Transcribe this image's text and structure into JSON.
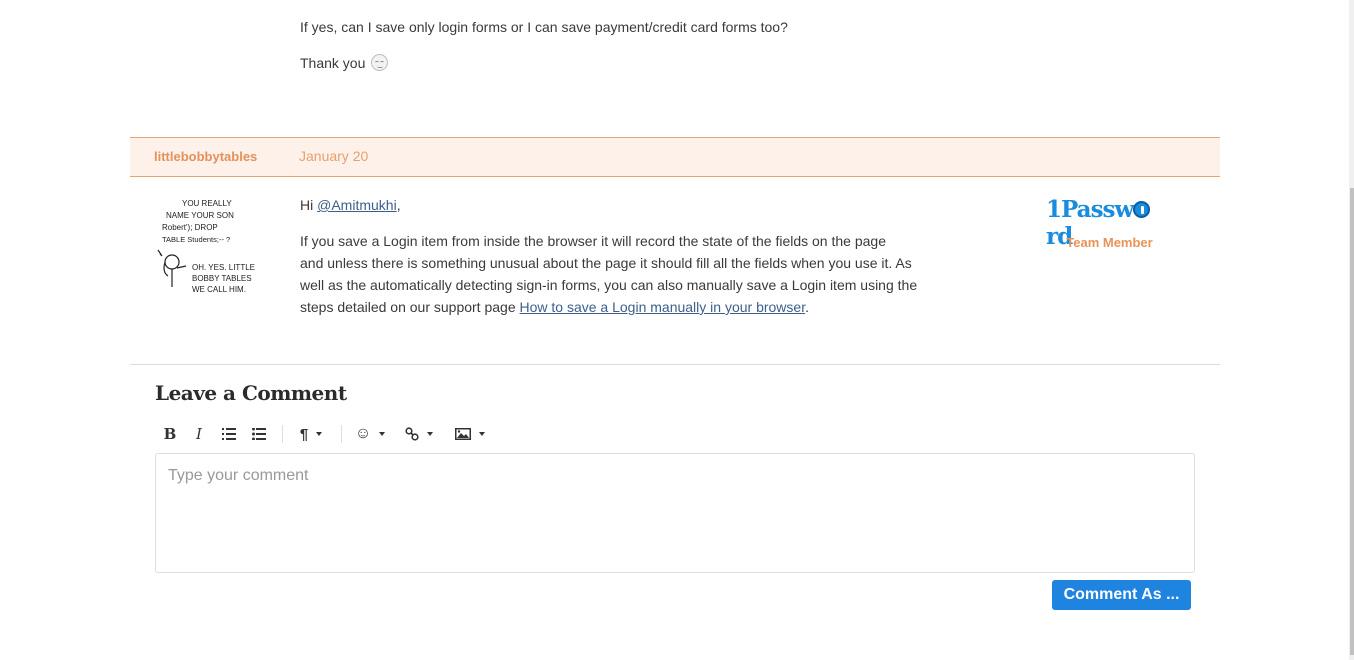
{
  "previous_post": {
    "question": "If yes, can I save only login forms or I can save payment/credit card forms too?",
    "thanks": "Thank you",
    "emoji": "smile-emoji"
  },
  "reply": {
    "author": "littlebobbytables",
    "date": "January 20",
    "avatar_icon": "xkcd-bobby-tables-avatar",
    "avatar_text": [
      "YOU REALLY",
      "NAME YOUR SON",
      "Robert'); DROP",
      "TABLE Students;-- ?",
      "OH. YES. LITTLE",
      "BOBBY TABLES",
      "WE CALL HIM."
    ],
    "greeting_prefix": "Hi ",
    "mention": "@Amitmukhi",
    "greeting_suffix": ",",
    "body_lines": [
      "If you save a Login item from inside the browser it will record the state of the fields on the page",
      "and unless there is something unusual about the page it should fill all the fields when you use it. As",
      "well as the automatically detecting sign-in forms, you can also manually save a Login item using the"
    ],
    "last_line_prefix": "steps detailed on our support page ",
    "support_link": "How to save a Login manually in your browser",
    "last_line_suffix": ".",
    "badge": {
      "logo_part1": "1Passw",
      "logo_part2": "rd",
      "role": "Team Member"
    }
  },
  "comment_form": {
    "title": "Leave a Comment",
    "toolbar": {
      "bold": "B",
      "italic": "I",
      "ordered_list": "ordered-list-icon",
      "unordered_list": "unordered-list-icon",
      "paragraph": "¶",
      "emoji": "☺",
      "link": "link-icon",
      "image": "image-icon"
    },
    "placeholder": "Type your comment",
    "value": "",
    "submit_label": "Comment As ..."
  },
  "colors": {
    "accent_orange": "#e2925c",
    "meta_bg": "#fef1e9",
    "link": "#3d5f8a",
    "button_blue": "#1f83e0",
    "brand_blue": "#1a8cdd"
  }
}
